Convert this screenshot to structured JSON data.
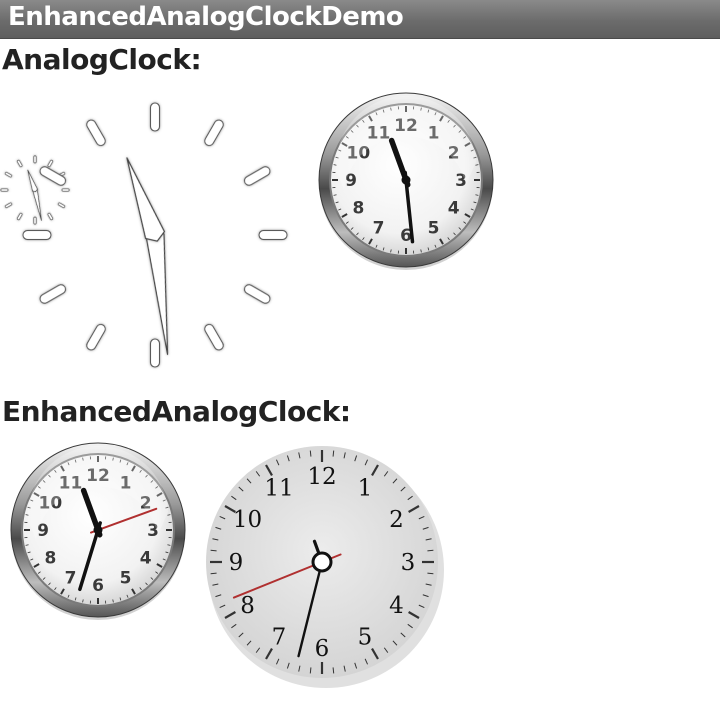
{
  "app": {
    "title": "EnhancedAnalogClockDemo"
  },
  "sections": {
    "analog": {
      "label": "AnalogClock:"
    },
    "enhanced": {
      "label": "EnhancedAnalogClock:"
    }
  },
  "clocks": {
    "numerals_arabic": [
      "12",
      "1",
      "2",
      "3",
      "4",
      "5",
      "6",
      "7",
      "8",
      "9",
      "10",
      "11"
    ],
    "numerals_serif": [
      "12",
      "1",
      "2",
      "3",
      "4",
      "5",
      "6",
      "7",
      "8",
      "9",
      "10",
      "11"
    ]
  },
  "colors": {
    "titlebar": "#6c6c6c",
    "second_hand": "#b03030",
    "hand": "#111111"
  },
  "icons": {
    "white_clock_small": "white-tick-clock-icon",
    "white_clock_large": "white-tick-clock-icon",
    "chrome_clock": "chrome-bezel-clock-icon",
    "plain_clock": "plain-dial-clock-icon"
  }
}
